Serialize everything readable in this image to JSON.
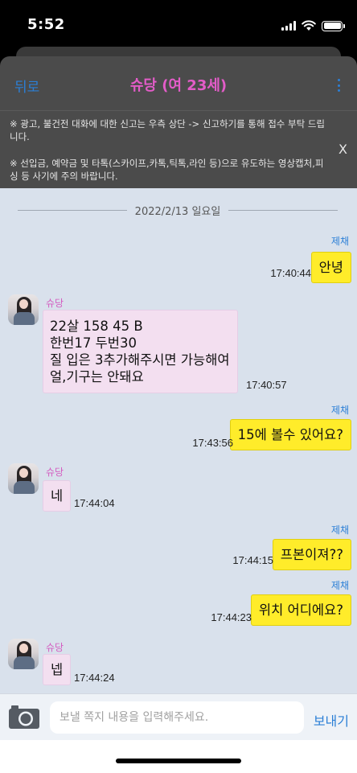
{
  "status_bar": {
    "time": "5:52"
  },
  "header": {
    "back_label": "뒤로",
    "title": "슈당 (여 23세)"
  },
  "notice": {
    "line1": "※ 광고, 불건전 대화에 대한 신고는 우측 상단 -> 신고하기를 통해 접수 부탁 드립니다.",
    "line2": "※ 선입금, 예약금 및 타톡(스카이프,카톡,틱톡,라인 등)으로 유도하는 영상캡처,피싱 등 사기에 주의 바랍니다.",
    "close": "X"
  },
  "chat": {
    "date": "2022/2/13 일요일",
    "messages": [
      {
        "from": "me",
        "sender": "제채",
        "text": "안녕",
        "time": "17:40:44"
      },
      {
        "from": "her",
        "sender": "슈당",
        "text": "22살 158 45 B\n한번17 두번30\n질 입은 3추가해주시면 가능해여\n얼,기구는 안돼요",
        "time": "17:40:57"
      },
      {
        "from": "me",
        "sender": "제채",
        "text": "15에 볼수 있어요?",
        "time": "17:43:56"
      },
      {
        "from": "her",
        "sender": "슈당",
        "text": "네",
        "time": "17:44:04"
      },
      {
        "from": "me",
        "sender": "제채",
        "text": "프본이져??",
        "time": "17:44:15"
      },
      {
        "from": "me",
        "sender": "제채",
        "text": "위치 어디에요?",
        "time": "17:44:23"
      },
      {
        "from": "her",
        "sender": "슈당",
        "text": "넵",
        "time": "17:44:24"
      }
    ]
  },
  "input": {
    "placeholder": "보낼 쪽지 내용을 입력해주세요.",
    "send_label": "보내기"
  },
  "colors": {
    "accent": "#2b7fd6",
    "name_pink": "#e35cc8",
    "my_bubble": "#ffec2a",
    "her_bubble": "#f3dff0",
    "chat_bg": "#d9e1ec"
  }
}
